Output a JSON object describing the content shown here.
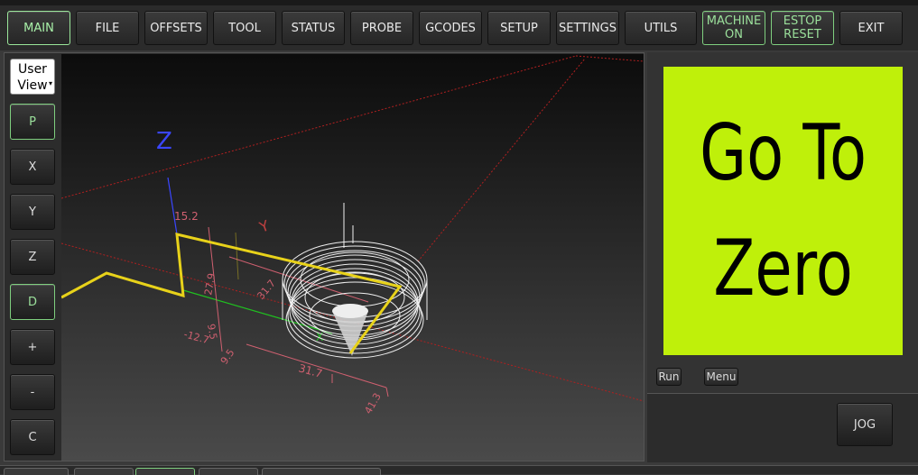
{
  "tabs": [
    {
      "label": "MAIN"
    },
    {
      "label": "FILE"
    },
    {
      "label": "OFFSETS"
    },
    {
      "label": "TOOL"
    },
    {
      "label": "STATUS"
    },
    {
      "label": "PROBE"
    },
    {
      "label": "GCODES"
    },
    {
      "label": "SETUP"
    },
    {
      "label": "SETTINGS"
    },
    {
      "label": "UTILS"
    },
    {
      "label": "MACHINE\nON"
    },
    {
      "label": "ESTOP\nRESET"
    },
    {
      "label": "EXIT"
    }
  ],
  "view_select": {
    "value": "User\nView"
  },
  "side_buttons": [
    "P",
    "X",
    "Y",
    "Z",
    "D",
    "+",
    "-",
    "C"
  ],
  "axes": {
    "x": "X",
    "y": "Y",
    "z": "Z"
  },
  "dimensions": [
    "15.2",
    "27.9",
    "31.7",
    "9.5",
    "-12.7",
    "9.5",
    "31.7",
    "41.3"
  ],
  "macro": {
    "image_text": "Go To\nZero",
    "run_label": "Run",
    "menu_label": "Menu"
  },
  "jog": {
    "label": "JOG"
  },
  "colors": {
    "accent_green": "#7fcf7f",
    "macro_bg": "#bff00a",
    "toolpath_yellow": "#e8d21a"
  }
}
